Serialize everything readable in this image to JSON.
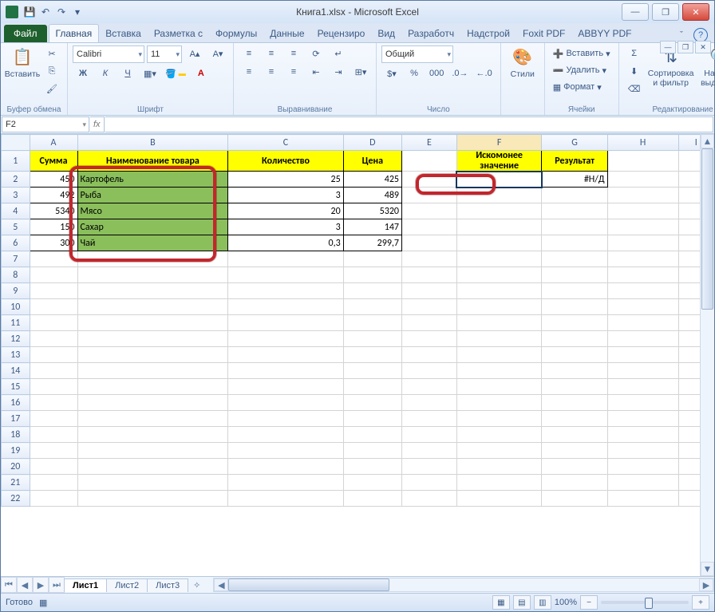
{
  "title": "Книга1.xlsx - Microsoft Excel",
  "qat": {
    "save": "💾",
    "undo": "↶",
    "redo": "↷",
    "more": "▾"
  },
  "tabs": {
    "file": "Файл",
    "items": [
      "Главная",
      "Вставка",
      "Разметка с",
      "Формулы",
      "Данные",
      "Рецензиро",
      "Вид",
      "Разработч",
      "Надстрой",
      "Foxit PDF",
      "ABBYY PDF"
    ],
    "active_index": 0
  },
  "ribbon": {
    "clipboard": {
      "paste": "Вставить",
      "label": "Буфер обмена"
    },
    "font": {
      "name": "Calibri",
      "size": "11",
      "label": "Шрифт",
      "bold": "Ж",
      "italic": "К",
      "underline": "Ч"
    },
    "align": {
      "label": "Выравнивание"
    },
    "number": {
      "format": "Общий",
      "label": "Число"
    },
    "styles": {
      "btn": "Стили",
      "label": ""
    },
    "cells": {
      "insert": "Вставить",
      "delete": "Удалить",
      "format": "Формат",
      "label": "Ячейки"
    },
    "editing": {
      "sigma": "Σ",
      "sort": "Сортировка и фильтр",
      "find": "Найти и выделить",
      "label": "Редактирование"
    }
  },
  "namebox": "F2",
  "fx": "fx",
  "columns": [
    "A",
    "B",
    "C",
    "D",
    "E",
    "F",
    "G",
    "H",
    "I"
  ],
  "row_numbers": [
    "1",
    "2",
    "3",
    "4",
    "5",
    "6",
    "7",
    "8",
    "9",
    "10",
    "11",
    "12",
    "13",
    "14",
    "15",
    "16",
    "17",
    "18",
    "19",
    "20",
    "21",
    "22"
  ],
  "headers": {
    "A": "Сумма",
    "B": "Наименование товара",
    "C": "Количество",
    "D": "Цена",
    "F_top": "Искомонее",
    "F_bot": "значение",
    "G": "Результат"
  },
  "data_rows": [
    {
      "A": "450",
      "B": "Картофель",
      "C": "25",
      "D": "425"
    },
    {
      "A": "492",
      "B": "Рыба",
      "C": "3",
      "D": "489"
    },
    {
      "A": "5340",
      "B": "Мясо",
      "C": "20",
      "D": "5320"
    },
    {
      "A": "150",
      "B": "Сахар",
      "C": "3",
      "D": "147"
    },
    {
      "A": "300",
      "B": "Чай",
      "C": "0,3",
      "D": "299,7"
    }
  ],
  "result_error": "#Н/Д",
  "sheet_tabs": [
    "Лист1",
    "Лист2",
    "Лист3"
  ],
  "status": {
    "ready": "Готово",
    "zoom": "100%"
  },
  "winbtns": {
    "min": "—",
    "max": "❐",
    "close": "✕"
  }
}
